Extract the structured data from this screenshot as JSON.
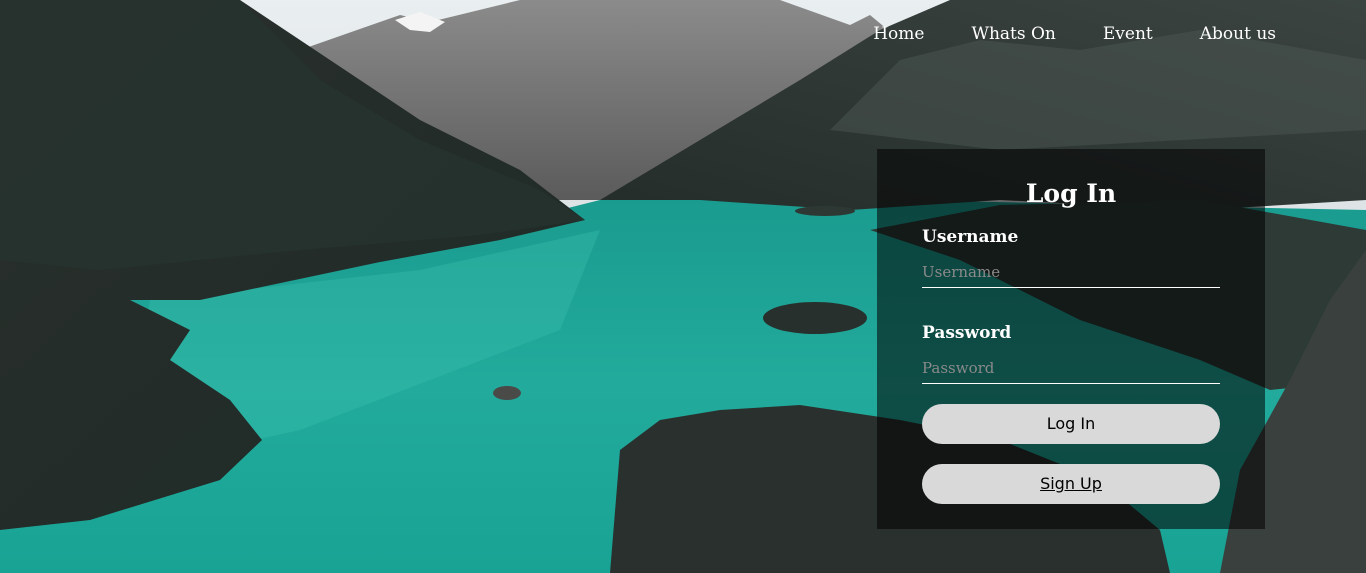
{
  "nav": {
    "items": [
      {
        "label": "Home"
      },
      {
        "label": "Whats On"
      },
      {
        "label": "Event"
      },
      {
        "label": "About us"
      }
    ]
  },
  "login": {
    "title": "Log In",
    "username_label": "Username",
    "username_placeholder": "Username",
    "password_label": "Password",
    "password_placeholder": "Password",
    "login_button": "Log In",
    "signup_button": "Sign Up"
  },
  "colors": {
    "water": "#1fa396",
    "panel": "rgba(0,0,0,0.55)",
    "button": "#d9d9d9"
  }
}
